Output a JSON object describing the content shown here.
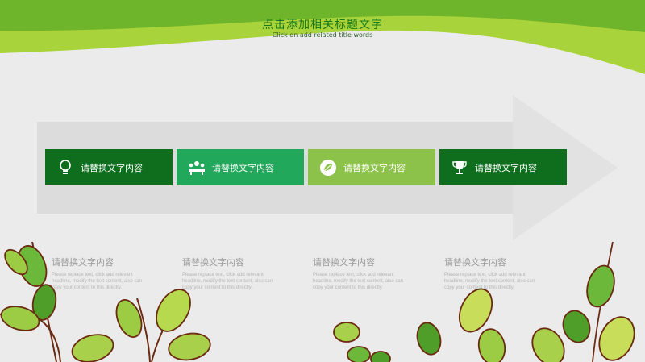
{
  "header": {
    "title": "点击添加相关标题文字",
    "subtitle": "Click on add related title words"
  },
  "colors": {
    "box1": "#0f6e1e",
    "box2": "#22a85a",
    "box3": "#8cc24a",
    "box4": "#0f6e1e",
    "band": "#dcdcdc",
    "arrow": "#e2e2e2"
  },
  "steps": [
    {
      "label": "请替换文字内容",
      "icon": "lightbulb-icon"
    },
    {
      "label": "请替换文字内容",
      "icon": "meeting-icon"
    },
    {
      "label": "请替换文字内容",
      "icon": "leaf-badge-icon"
    },
    {
      "label": "请替换文字内容",
      "icon": "trophy-icon"
    }
  ],
  "descriptions": [
    {
      "heading": "请替换文字内容",
      "body": "Please replace text, click add relevant headline, modify the text content, also can copy your content to this directly."
    },
    {
      "heading": "请替换文字内容",
      "body": "Please replace text, click add relevant headline, modify the text content, also can copy your content to this directly."
    },
    {
      "heading": "请替换文字内容",
      "body": "Please replace text, click add relevant headline, modify the text content, also can copy your content to this directly."
    },
    {
      "heading": "请替换文字内容",
      "body": "Please replace text, click add relevant headline, modify the text content, also can copy your content to this directly."
    }
  ]
}
